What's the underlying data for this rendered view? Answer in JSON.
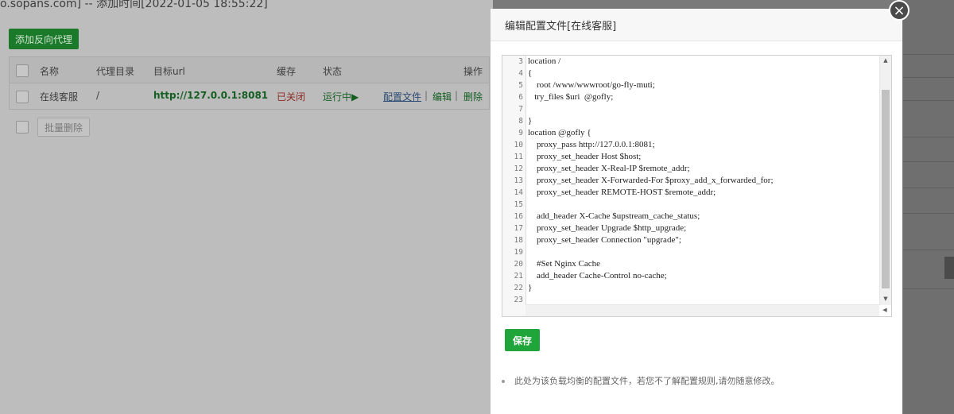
{
  "background": {
    "title": "o.sopans.com] -- 添加时间[2022-01-05 18:55:22]",
    "add_button": "添加反向代理",
    "columns": [
      "名称",
      "代理目录",
      "目标url",
      "缓存",
      "状态",
      "操作"
    ],
    "row": {
      "name": "在线客服",
      "dir": "/",
      "url": "http://127.0.0.1:8081",
      "cache": "已关闭",
      "status": "运行中▶",
      "action_config": "配置文件",
      "action_edit": "编辑",
      "action_delete": "删除",
      "separator": "|"
    },
    "batch_delete": "批量删除"
  },
  "modal": {
    "title": "编辑配置文件[在线客服]",
    "close": "×",
    "save": "保存",
    "note": "此处为该负载均衡的配置文件，若您不了解配置规则,请勿随意修改。"
  },
  "editor": {
    "lines": [
      {
        "n": "3",
        "text": "location /"
      },
      {
        "n": "4",
        "text": "{"
      },
      {
        "n": "5",
        "text": "    root /www/wwwroot/go-fly-muti;"
      },
      {
        "n": "6",
        "text": "   try_files $uri  @gofly;"
      },
      {
        "n": "7",
        "text": ""
      },
      {
        "n": "8",
        "text": "}"
      },
      {
        "n": "9",
        "text": "location @gofly {"
      },
      {
        "n": "10",
        "text": "    proxy_pass http://127.0.0.1:8081;"
      },
      {
        "n": "11",
        "text": "    proxy_set_header Host $host;"
      },
      {
        "n": "12",
        "text": "    proxy_set_header X-Real-IP $remote_addr;"
      },
      {
        "n": "13",
        "text": "    proxy_set_header X-Forwarded-For $proxy_add_x_forwarded_for;"
      },
      {
        "n": "14",
        "text": "    proxy_set_header REMOTE-HOST $remote_addr;"
      },
      {
        "n": "15",
        "text": ""
      },
      {
        "n": "16",
        "text": "    add_header X-Cache $upstream_cache_status;"
      },
      {
        "n": "17",
        "text": "    proxy_set_header Upgrade $http_upgrade;"
      },
      {
        "n": "18",
        "text": "    proxy_set_header Connection \"upgrade\";"
      },
      {
        "n": "19",
        "text": ""
      },
      {
        "n": "20",
        "text": "    #Set Nginx Cache"
      },
      {
        "n": "21",
        "text": "    add_header Cache-Control no-cache;"
      },
      {
        "n": "22",
        "text": "}"
      },
      {
        "n": "23",
        "text": ""
      }
    ],
    "scroll_up": "▲",
    "scroll_down": "▼",
    "scroll_left": "◀",
    "scroll_right": "▶"
  }
}
